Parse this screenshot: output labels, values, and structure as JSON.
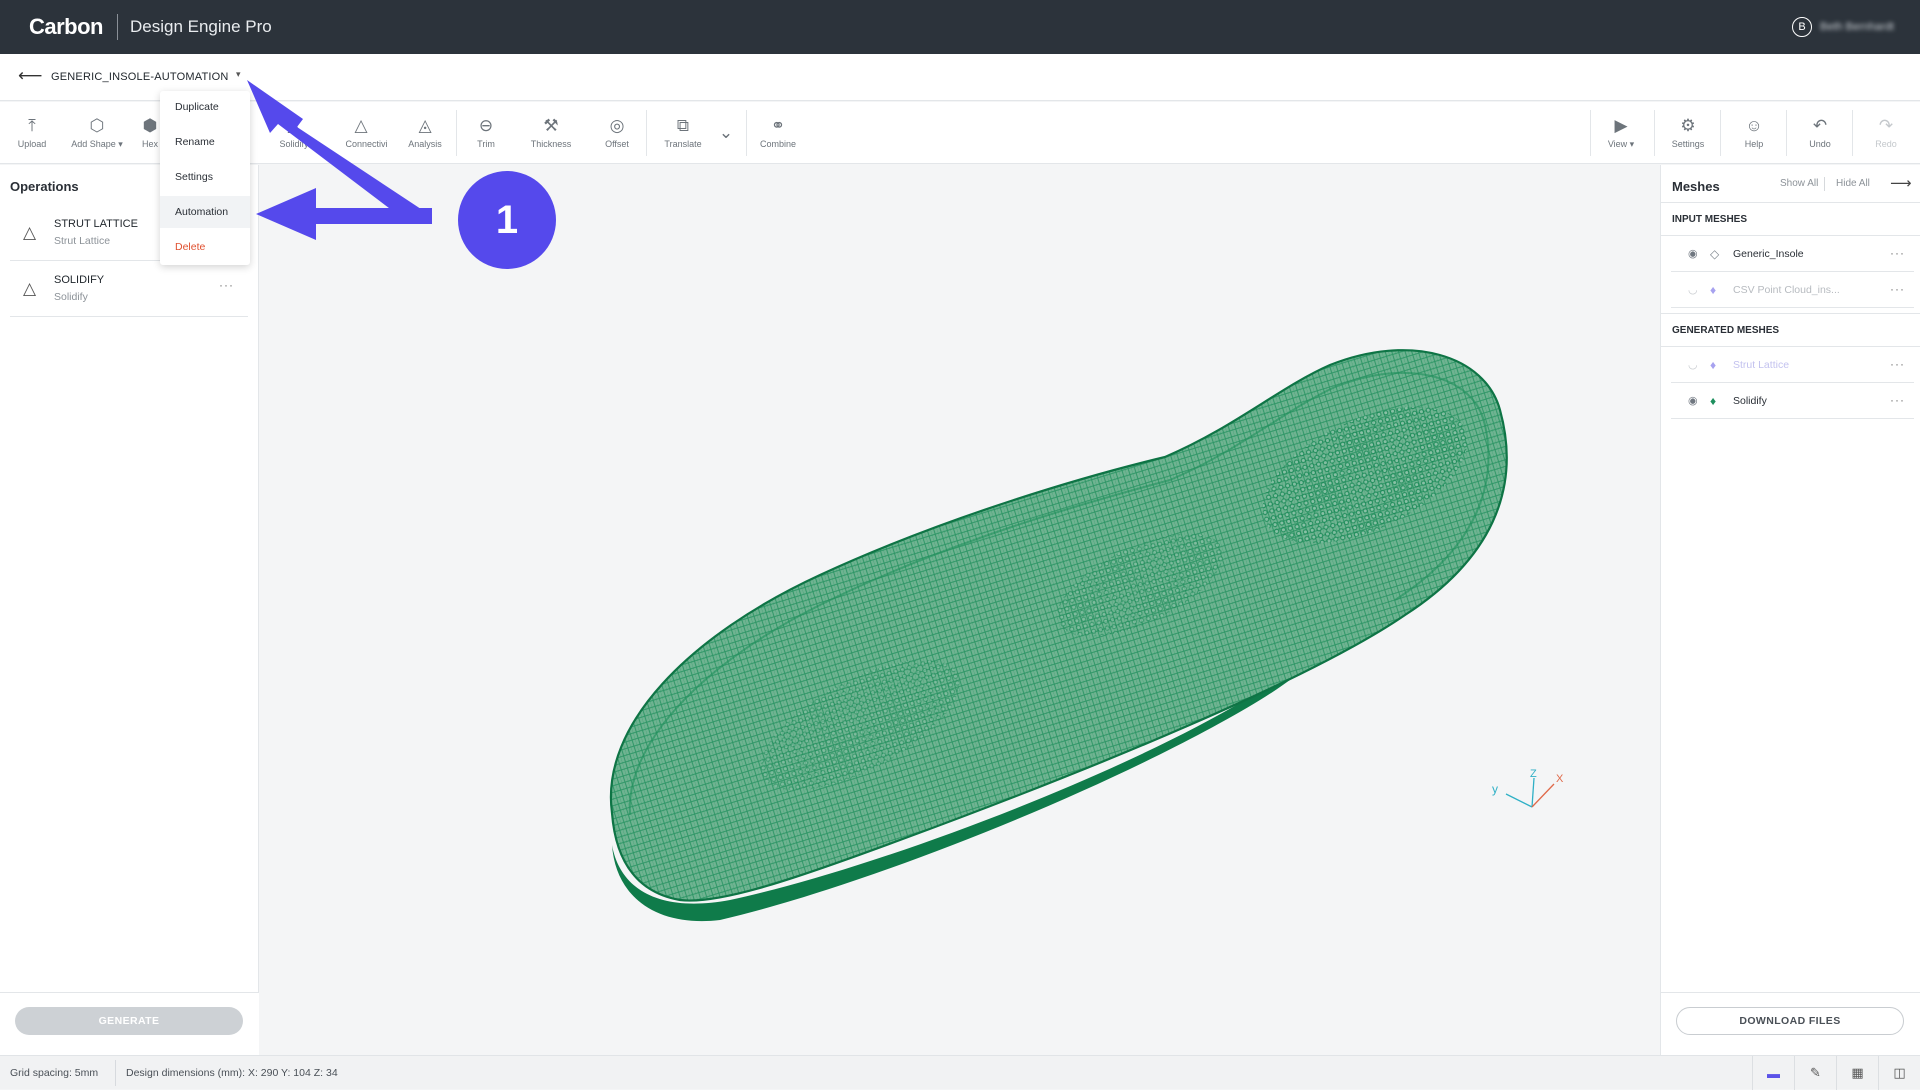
{
  "topbar": {
    "brand": "Carbon",
    "product": "Design Engine Pro",
    "user_initial": "B",
    "user_name": "Beth Bernhardt"
  },
  "project": {
    "back_icon": "arrow-left-icon",
    "name": "GENERIC_INSOLE-AUTOMATION",
    "caret": "▾"
  },
  "toolbar": {
    "upload": "Upload",
    "add_shape": "Add Shape ▾",
    "hex": "Hex",
    "solidify": "Solidify",
    "connectivity": "Connectivity",
    "analysis": "Analysis",
    "trim": "Trim",
    "thickness": "Thickness",
    "offset": "Offset",
    "translate": "Translate",
    "combine": "Combine",
    "view": "View ▾",
    "settings": "Settings",
    "help": "Help",
    "undo": "Undo",
    "redo": "Redo"
  },
  "dropdown": {
    "items": [
      "Duplicate",
      "Rename",
      "Settings",
      "Automation",
      "Delete"
    ],
    "highlighted": "Automation"
  },
  "operations": {
    "title": "Operations",
    "items": [
      {
        "name": "STRUT LATTICE",
        "type": "Strut Lattice"
      },
      {
        "name": "SOLIDIFY",
        "type": "Solidify"
      }
    ],
    "more": "···"
  },
  "generate_label": "GENERATE",
  "meshes": {
    "title": "Meshes",
    "show_all": "Show All",
    "hide_all": "Hide All",
    "input_title": "INPUT MESHES",
    "input": [
      {
        "name": "Generic_Insole",
        "visible": true,
        "color": "#7d858c"
      },
      {
        "name": "CSV Point Cloud_ins...",
        "visible": false,
        "color": "#a7a2ef"
      }
    ],
    "generated_title": "GENERATED MESHES",
    "generated": [
      {
        "name": "Strut Lattice",
        "visible": false,
        "color": "#a7a2ef"
      },
      {
        "name": "Solidify",
        "visible": true,
        "color": "#1e8f5e"
      }
    ],
    "more": "···"
  },
  "download_label": "DOWNLOAD FILES",
  "status": {
    "grid": "Grid spacing: 5mm",
    "dimensions": "Design dimensions (mm): X: 290  Y: 104  Z: 34"
  },
  "axes": {
    "x": "X",
    "y": "y",
    "z": "Z"
  },
  "annotation": {
    "number": "1",
    "color": "#5549ec"
  },
  "colors": {
    "accent": "#5b53e8",
    "mesh": "#1e8f5e",
    "delete": "#e0502f"
  }
}
